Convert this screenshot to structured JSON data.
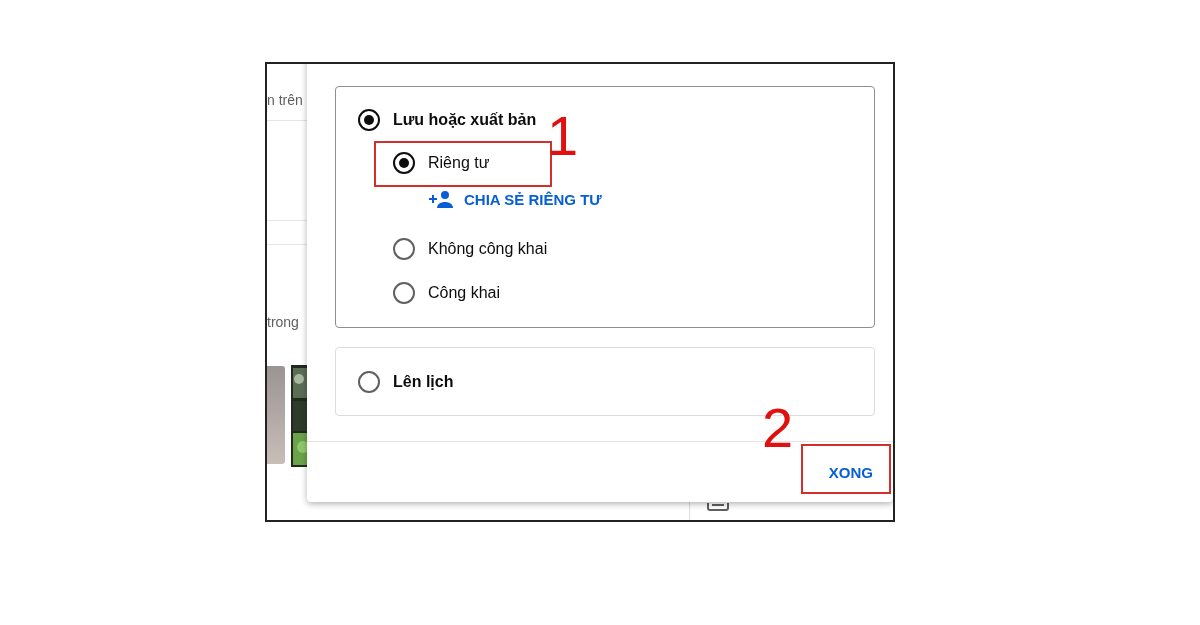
{
  "background": {
    "texts": [
      "n trên",
      "trong"
    ]
  },
  "publish_section": {
    "option": {
      "label": "Lưu hoặc xuất bản",
      "selected": true
    },
    "share_link": "CHIA SẺ RIÊNG TƯ",
    "visibility": [
      {
        "label": "Riêng tư",
        "selected": true
      },
      {
        "label": "Không công khai",
        "selected": false
      },
      {
        "label": "Công khai",
        "selected": false
      }
    ]
  },
  "schedule_section": {
    "option": {
      "label": "Lên lịch",
      "selected": false
    }
  },
  "done_button": "XONG",
  "annotations": [
    "1",
    "2"
  ]
}
